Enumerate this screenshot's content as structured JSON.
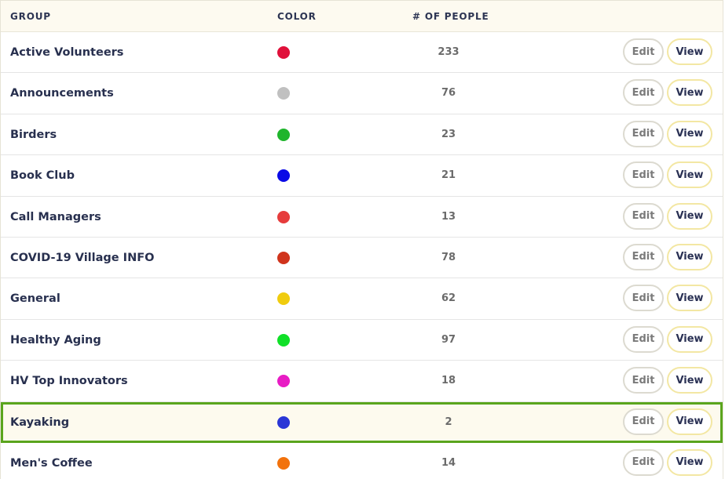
{
  "headers": {
    "group": "GROUP",
    "color": "COLOR",
    "people": "# OF PEOPLE"
  },
  "buttons": {
    "edit": "Edit",
    "view": "View"
  },
  "rows": [
    {
      "name": "Active Volunteers",
      "color": "#e0103a",
      "count": "233"
    },
    {
      "name": "Announcements",
      "color": "#c0c0c0",
      "count": "76"
    },
    {
      "name": "Birders",
      "color": "#1fb52c",
      "count": "23"
    },
    {
      "name": "Book Club",
      "color": "#0a0ae6",
      "count": "21"
    },
    {
      "name": "Call Managers",
      "color": "#e63c3c",
      "count": "13"
    },
    {
      "name": "COVID-19 Village INFO",
      "color": "#d0341c",
      "count": "78"
    },
    {
      "name": "General",
      "color": "#f0cc0e",
      "count": "62"
    },
    {
      "name": "Healthy Aging",
      "color": "#10e028",
      "count": "97"
    },
    {
      "name": "HV Top Innovators",
      "color": "#e81cc4",
      "count": "18"
    },
    {
      "name": "Kayaking",
      "color": "#2a36d6",
      "count": "2",
      "selected": true
    },
    {
      "name": "Men's Coffee",
      "color": "#f2720c",
      "count": "14"
    }
  ]
}
